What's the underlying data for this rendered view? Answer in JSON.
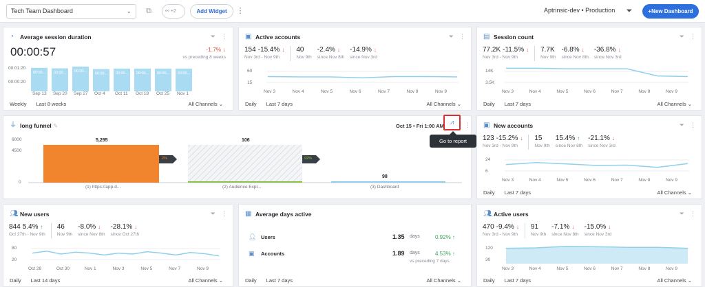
{
  "topbar": {
    "dashboard_name": "Tech Team Dashboard",
    "share_count": "+2",
    "add_widget": "Add Widget",
    "environment": "Aptrinsic-dev • Production",
    "new_dashboard": "+New Dashboard"
  },
  "avg_session": {
    "title": "Average session duration",
    "value": "00:00:57",
    "change": "-1.7%",
    "vs": "vs preceding 8 weeks",
    "y_ticks": [
      "00:01:20",
      "00:00:20"
    ],
    "bar_label": "00:00...",
    "categories": [
      "Sep 13",
      "Sep 20",
      "Sep 27",
      "Oct 4",
      "Oct 11",
      "Oct 18",
      "Oct 25",
      "Nov 1"
    ],
    "values": [
      0.95,
      0.93,
      1.0,
      0.9,
      0.92,
      0.92,
      0.92,
      0.92
    ],
    "period": "Weekly",
    "range": "Last 8 weeks",
    "channel": "All Channels"
  },
  "active_accounts": {
    "title": "Active accounts",
    "m1": "154",
    "m1_change": "-15.4%",
    "m1_sub": "Nov 3rd - Nov 9th",
    "m2": "40",
    "m2_sub": "Nov 9th",
    "m3_change": "-2.4%",
    "m3_sub": "since Nov 8th",
    "m4_change": "-14.9%",
    "m4_sub": "since Nov 3rd",
    "y_ticks": [
      "60",
      "15"
    ],
    "x_ticks": [
      "Nov 3",
      "Nov 4",
      "Nov 5",
      "Nov 6",
      "Nov 7",
      "Nov 8",
      "Nov 9"
    ],
    "period": "Daily",
    "range": "Last 7 days",
    "channel": "All Channels"
  },
  "session_count": {
    "title": "Session count",
    "m1": "77.2K",
    "m1_change": "-11.5%",
    "m1_sub": "Nov 3rd - Nov 9th",
    "m2": "7.7K",
    "m2_sub": "Nov 9th",
    "m3_change": "-6.8%",
    "m3_sub": "since Nov 8th",
    "m4_change": "-36.8%",
    "m4_sub": "since Nov 3rd",
    "y_ticks": [
      "14K",
      "3.5K"
    ],
    "x_ticks": [
      "Nov 3",
      "Nov 4",
      "Nov 5",
      "Nov 6",
      "Nov 7",
      "Nov 8",
      "Nov 9"
    ],
    "period": "Daily",
    "range": "Last 7 days",
    "channel": "All Channels"
  },
  "funnel": {
    "title": "long funnel",
    "date": "Oct 15 • Fri 1:00 AM",
    "tooltip": "Go to report",
    "y_ticks": [
      "6000",
      "4500",
      "0"
    ],
    "steps": [
      {
        "label": "(1) https://app-d...",
        "value": "5,295"
      },
      {
        "label": "(2) Audience Expl...",
        "value": "106"
      },
      {
        "label": "(3) Dashboard",
        "value": "98"
      }
    ],
    "conv1": "2%",
    "conv2": "92%"
  },
  "new_accounts": {
    "title": "New accounts",
    "m1": "123",
    "m1_change": "-15.2%",
    "m1_sub": "Nov 3rd - Nov 9th",
    "m2": "15",
    "m2_sub": "Nov 9th",
    "m3_change": "15.4%",
    "m3_sub": "since Nov 8th",
    "m4_change": "-21.1%",
    "m4_sub": "since Nov 3rd",
    "y_ticks": [
      "24",
      "6"
    ],
    "x_ticks": [
      "Nov 3",
      "Nov 4",
      "Nov 5",
      "Nov 6",
      "Nov 7",
      "Nov 8",
      "Nov 9"
    ],
    "period": "Daily",
    "range": "Last 7 days",
    "channel": "All Channels"
  },
  "new_users": {
    "title": "New users",
    "m1": "844",
    "m1_change": "5.4%",
    "m1_sub": "Oct 27th - Nov 9th",
    "m2": "46",
    "m2_sub": "Nov 9th",
    "m3_change": "-8.0%",
    "m3_sub": "since Nov 8th",
    "m4_change": "-28.1%",
    "m4_sub": "since Oct 27th",
    "y_ticks": [
      "80",
      "20"
    ],
    "x_ticks": [
      "Oct 28",
      "Oct 30",
      "Nov 1",
      "Nov 3",
      "Nov 5",
      "Nov 7",
      "Nov 9"
    ],
    "period": "Daily",
    "range": "Last 14 days",
    "channel": "All Channels"
  },
  "avg_days_active": {
    "title": "Average days active",
    "users_label": "Users",
    "users_value": "1.35",
    "users_unit": "days",
    "users_change": "0.92%",
    "accounts_label": "Accounts",
    "accounts_value": "1.89",
    "accounts_unit": "days",
    "accounts_change": "4.53%",
    "vs": "vs preceding 7 days",
    "period": "Daily",
    "range": "Last 7 days",
    "channel": "All Channels"
  },
  "active_users": {
    "title": "Active users",
    "m1": "470",
    "m1_change": "-9.4%",
    "m1_sub": "Nov 3rd - Nov 9th",
    "m2": "91",
    "m2_sub": "Nov 9th",
    "m3_change": "-7.1%",
    "m3_sub": "since Nov 8th",
    "m4_change": "-15.0%",
    "m4_sub": "since Nov 3rd",
    "y_ticks": [
      "120",
      "30"
    ],
    "x_ticks": [
      "Nov 3",
      "Nov 4",
      "Nov 5",
      "Nov 6",
      "Nov 7",
      "Nov 8",
      "Nov 9"
    ],
    "period": "Daily",
    "range": "Last 7 days",
    "channel": "All Channels"
  },
  "colors": {
    "accent": "#2d6fdc",
    "line": "#8fd0ea",
    "area": "#cfeaf7",
    "bar": "#a9dcf3",
    "funnel_orange": "#f0852d",
    "down": "#e0533f",
    "up": "#3ba55c"
  }
}
